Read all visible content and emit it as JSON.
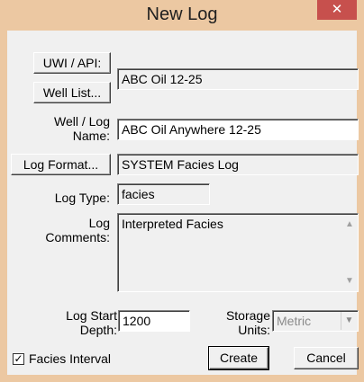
{
  "window": {
    "title": "New Log",
    "close_glyph": "✕"
  },
  "form": {
    "uwi_button": "UWI / API:",
    "well_list_button": "Well List...",
    "uwi_value": "ABC Oil 12-25",
    "well_log_name_label": [
      "Well / Log",
      "Name:"
    ],
    "well_log_name_value": "ABC Oil Anywhere 12-25",
    "log_format_button": "Log Format...",
    "log_format_value": "SYSTEM Facies Log",
    "log_type_label": "Log Type:",
    "log_type_value": "facies",
    "log_comments_label": [
      "Log",
      "Comments:"
    ],
    "log_comments_value": "Interpreted Facies",
    "log_start_depth_label": [
      "Log Start",
      "Depth:"
    ],
    "log_start_depth_value": "1200",
    "storage_units_label": [
      "Storage",
      "Units:"
    ],
    "storage_units_value": "Metric",
    "facies_interval_label": "Facies Interval",
    "facies_interval_checked": true,
    "create_button": "Create",
    "cancel_button": "Cancel"
  },
  "icons": {
    "close": "close-icon",
    "scroll_up": "chevron-up-icon",
    "scroll_down": "chevron-down-icon",
    "dropdown": "chevron-down-icon",
    "check": "checkmark-icon"
  },
  "colors": {
    "title_bar": "#ecc8a2",
    "close_button": "#c7504d",
    "dialog_bg": "#f0f0f0"
  }
}
